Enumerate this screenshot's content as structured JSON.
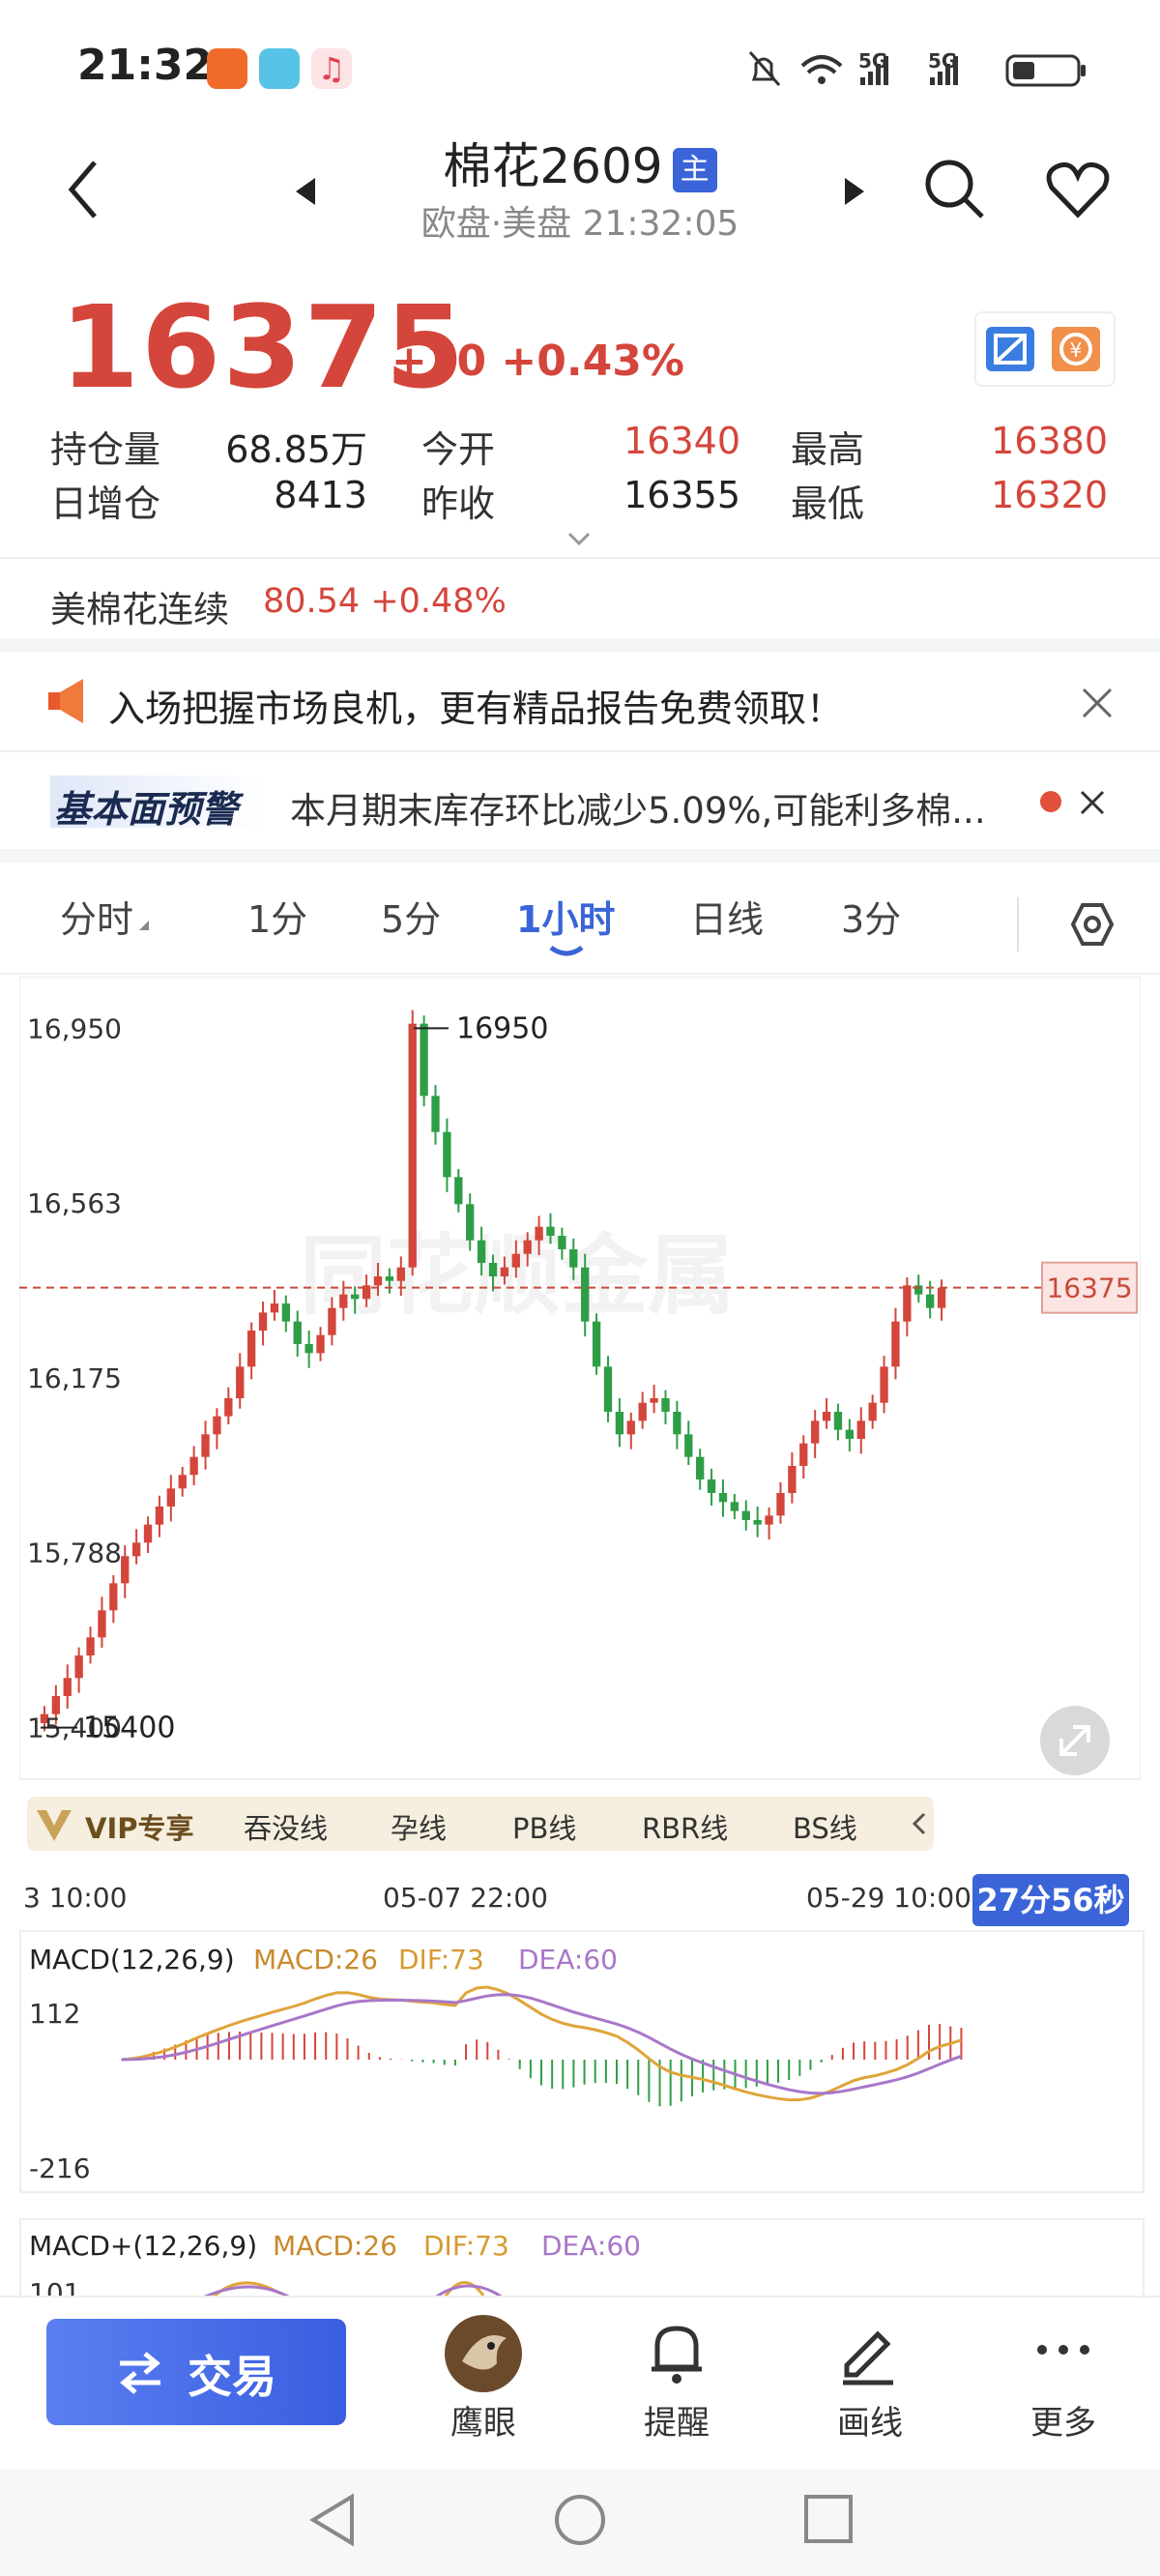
{
  "status_bar": {
    "time": "21:32",
    "signal1": "5G",
    "signal2": "5G"
  },
  "header": {
    "title": "棉花2609",
    "badge": "主",
    "subtitle": "欧盘·美盘   21:32:05"
  },
  "quote": {
    "price": "16375",
    "change": "+70 +0.43%",
    "stats": [
      {
        "label": "持仓量",
        "value": "68.85万"
      },
      {
        "label": "日增仓",
        "value": "8413"
      },
      {
        "label": "今开",
        "value": "16340"
      },
      {
        "label": "昨收",
        "value": "16355"
      },
      {
        "label": "最高",
        "value": "16380"
      },
      {
        "label": "最低",
        "value": "16320"
      }
    ]
  },
  "related": {
    "name": "美棉花连续",
    "value": "80.54 +0.48%"
  },
  "banner": {
    "text": "入场把握市场良机，更有精品报告免费领取！"
  },
  "alert": {
    "tag": "基本面预警",
    "text": "本月期末库存环比减少5.09%,可能利多棉..."
  },
  "tabs": [
    {
      "label": "分时",
      "active": false
    },
    {
      "label": "1分",
      "active": false
    },
    {
      "label": "5分",
      "active": false
    },
    {
      "label": "1小时",
      "active": true
    },
    {
      "label": "日线",
      "active": false
    },
    {
      "label": "3分",
      "active": false
    }
  ],
  "chart": {
    "y_ticks": [
      "16,950",
      "16,563",
      "16,175",
      "15,788",
      "15,400"
    ],
    "high_marker": "16950",
    "low_marker": "15400",
    "current_price_tag": "16375",
    "x_ticks": [
      "3 10:00",
      "05-07 22:00",
      "05-29 10:00"
    ],
    "countdown": "27分56秒",
    "watermark": "同花顺金属"
  },
  "chart_data": {
    "type": "candlestick",
    "ylim": [
      15350,
      17000
    ],
    "current_price": 16375,
    "high": 16950,
    "low": 15400,
    "close_series": [
      15430,
      15470,
      15510,
      15560,
      15600,
      15660,
      15720,
      15780,
      15810,
      15850,
      15890,
      15930,
      15960,
      16000,
      16050,
      16090,
      16130,
      16200,
      16280,
      16320,
      16340,
      16300,
      16250,
      16230,
      16270,
      16330,
      16360,
      16350,
      16380,
      16400,
      16390,
      16420,
      16960,
      16800,
      16720,
      16620,
      16560,
      16480,
      16430,
      16400,
      16420,
      16450,
      16480,
      16510,
      16490,
      16460,
      16420,
      16300,
      16200,
      16100,
      16050,
      16080,
      16120,
      16130,
      16100,
      16050,
      16000,
      15950,
      15920,
      15900,
      15880,
      15860,
      15850,
      15870,
      15920,
      15980,
      16030,
      16080,
      16100,
      16060,
      16040,
      16080,
      16120,
      16200,
      16300,
      16380,
      16360,
      16330,
      16375
    ]
  },
  "indicator_chips": {
    "vip": "VIP专享",
    "items": [
      "吞没线",
      "孕线",
      "PB线",
      "RBR线",
      "BS线"
    ]
  },
  "macd1": {
    "title": "MACD(12,26,9)",
    "macd": "MACD:26",
    "dif": "DIF:73",
    "dea": "DEA:60",
    "top": "112",
    "bottom": "-216"
  },
  "macd2": {
    "title": "MACD+(12,26,9)",
    "macd": "MACD:26",
    "dif": "DIF:73",
    "dea": "DEA:60",
    "top": "101"
  },
  "bottom_nav": {
    "trade": "交易",
    "items": [
      "鹰眼",
      "提醒",
      "画线",
      "更多"
    ]
  },
  "colors": {
    "up": "#d4453b",
    "down": "#2e9e46",
    "accent": "#3a64d8",
    "dif": "#e0a43a",
    "dea": "#a877c8"
  }
}
